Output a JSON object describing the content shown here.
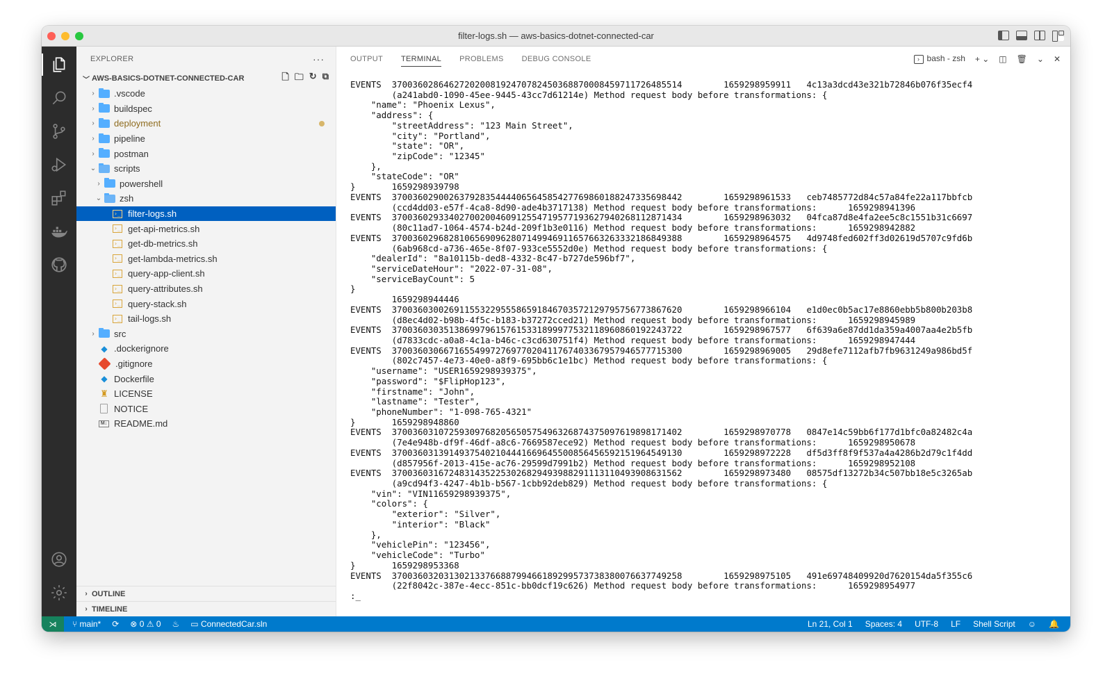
{
  "window": {
    "title": "filter-logs.sh — aws-basics-dotnet-connected-car"
  },
  "sidebar": {
    "header": "EXPLORER",
    "more": "···",
    "root": "AWS-BASICS-DOTNET-CONNECTED-CAR",
    "items": [
      {
        "label": ".vscode",
        "type": "folder"
      },
      {
        "label": "buildspec",
        "type": "folder"
      },
      {
        "label": "deployment",
        "type": "folder",
        "modified": true
      },
      {
        "label": "pipeline",
        "type": "folder"
      },
      {
        "label": "postman",
        "type": "folder"
      },
      {
        "label": "scripts",
        "type": "folder-open"
      },
      {
        "label": "powershell",
        "type": "folder"
      },
      {
        "label": "zsh",
        "type": "folder-open"
      },
      {
        "label": "filter-logs.sh",
        "type": "file"
      },
      {
        "label": "get-api-metrics.sh",
        "type": "file"
      },
      {
        "label": "get-db-metrics.sh",
        "type": "file"
      },
      {
        "label": "get-lambda-metrics.sh",
        "type": "file"
      },
      {
        "label": "query-app-client.sh",
        "type": "file"
      },
      {
        "label": "query-attributes.sh",
        "type": "file"
      },
      {
        "label": "query-stack.sh",
        "type": "file"
      },
      {
        "label": "tail-logs.sh",
        "type": "file"
      },
      {
        "label": "src",
        "type": "folder"
      },
      {
        "label": ".dockerignore",
        "type": "docker"
      },
      {
        "label": ".gitignore",
        "type": "git"
      },
      {
        "label": "Dockerfile",
        "type": "docker"
      },
      {
        "label": "LICENSE",
        "type": "license"
      },
      {
        "label": "NOTICE",
        "type": "notice"
      },
      {
        "label": "README.md",
        "type": "markdown"
      }
    ],
    "outline": "OUTLINE",
    "timeline": "TIMELINE"
  },
  "panel": {
    "tabs": [
      "OUTPUT",
      "TERMINAL",
      "PROBLEMS",
      "DEBUG CONSOLE"
    ],
    "active_tab": "TERMINAL",
    "terminal_name": "bash - zsh"
  },
  "terminal": {
    "lines": [
      "EVENTS  37003602864627202008192470782450368870008459711726485514        1659298959911   4c13a3dcd43e321b72846b076f35ecf4",
      "        (a241abd0-1090-45ee-9445-43cc7d61214e) Method request body before transformations: {",
      "    \"name\": \"Phoenix Lexus\",",
      "    \"address\": {",
      "        \"streetAddress\": \"123 Main Street\",",
      "        \"city\": \"Portland\",",
      "        \"state\": \"OR\",",
      "        \"zipCode\": \"12345\"",
      "    },",
      "    \"stateCode\": \"OR\"",
      "}       1659298939798",
      "EVENTS  37003602900263792835444406564585427769860188247335698442        1659298961533   ceb7485772d84c57a84fe22a117bbfcb",
      "        (ccd4dd03-e57f-4ca8-8d90-ade4b3717138) Method request body before transformations:      1659298941396",
      "EVENTS  37003602933402700200460912554719577193627940268112871434        1659298963032   04fca87d8e4fa2ee5c8c1551b31c6697",
      "        (80c11ad7-1064-4574-b24d-209f1b3e0116) Method request body before transformations:      1659298942882",
      "EVENTS  37003602968281065690962807149946911657663263332186849388        1659298964575   4d9748fed602ff3d02619d5707c9fd6b",
      "        (6ab968cd-a736-465e-8f07-933ce5552d0e) Method request body before transformations: {",
      "    \"dealerId\": \"8a10115b-ded8-4332-8c47-b727de596bf7\",",
      "    \"serviceDateHour\": \"2022-07-31-08\",",
      "    \"serviceBayCount\": 5",
      "}",
      "        1659298944446",
      "EVENTS  37003603002691155322955586591846703572129795756773867620        1659298966104   e1d0ec0b5ac17e8860ebb5b800b203b8",
      "        (d8ec4d02-b98b-4f5c-b183-b37272cced21) Method request body before transformations:      1659298945989",
      "EVENTS  37003603035138699796157615331899977532118960860192243722        1659298967577   6f639a6e87dd1da359a4007aa4e2b5fb",
      "        (d7833cdc-a0a8-4c1a-b46c-c3cd630751f4) Method request body before transformations:      1659298947444",
      "EVENTS  37003603066716554997276977020411767403367957946577715300        1659298969005   29d8efe7112afb7fb9631249a986bd5f",
      "        (802c7457-4e73-40e0-a8f9-695bb6c1e1bc) Method request body before transformations: {",
      "    \"username\": \"USER1659298939375\",",
      "    \"password\": \"$FlipHop123\",",
      "    \"firstname\": \"John\",",
      "    \"lastname\": \"Tester\",",
      "    \"phoneNumber\": \"1-098-765-4321\"",
      "}       1659298948860",
      "EVENTS  37003603107259309768205650575496326874375097619898171402        1659298970778   0847e14c59bb6f177d1bfc0a82482c4a",
      "        (7e4e948b-df9f-46df-a8c6-7669587ece92) Method request body before transformations:      1659298950678",
      "EVENTS  37003603139149375402104441669645500856456592151964549130        1659298972228   df5d3ff8f9f537a4a4286b2d79c1f4dd",
      "        (d857956f-2013-415e-ac76-29599d7991b2) Method request body before transformations:      1659298952108",
      "EVENTS  37003603167248314352253026829493988291113110493908631562        1659298973480   08575df13272b34c507bb18e5c3265ab",
      "        (a9cd94f3-4247-4b1b-b567-1cbb92deb829) Method request body before transformations: {",
      "    \"vin\": \"VIN11659298939375\",",
      "    \"colors\": {",
      "        \"exterior\": \"Silver\",",
      "        \"interior\": \"Black\"",
      "    },",
      "    \"vehiclePin\": \"123456\",",
      "    \"vehicleCode\": \"Turbo\"",
      "}       1659298953368",
      "EVENTS  37003603203130213376688799466189299573738380076637749258        1659298975105   491e69748409920d7620154da5f355c6",
      "        (22f8042c-387e-4ecc-851c-bb0dcf19c626) Method request body before transformations:      1659298954977",
      ":_"
    ]
  },
  "statusbar": {
    "branch": "main*",
    "errors": "0",
    "warnings": "0",
    "solution": "ConnectedCar.sln",
    "position": "Ln 21, Col 1",
    "spaces": "Spaces: 4",
    "encoding": "UTF-8",
    "eol": "LF",
    "language": "Shell Script"
  },
  "colors": {
    "accent": "#007acc",
    "selection": "#0060c0",
    "activitybar": "#2c2c2c",
    "remote": "#16825d"
  }
}
